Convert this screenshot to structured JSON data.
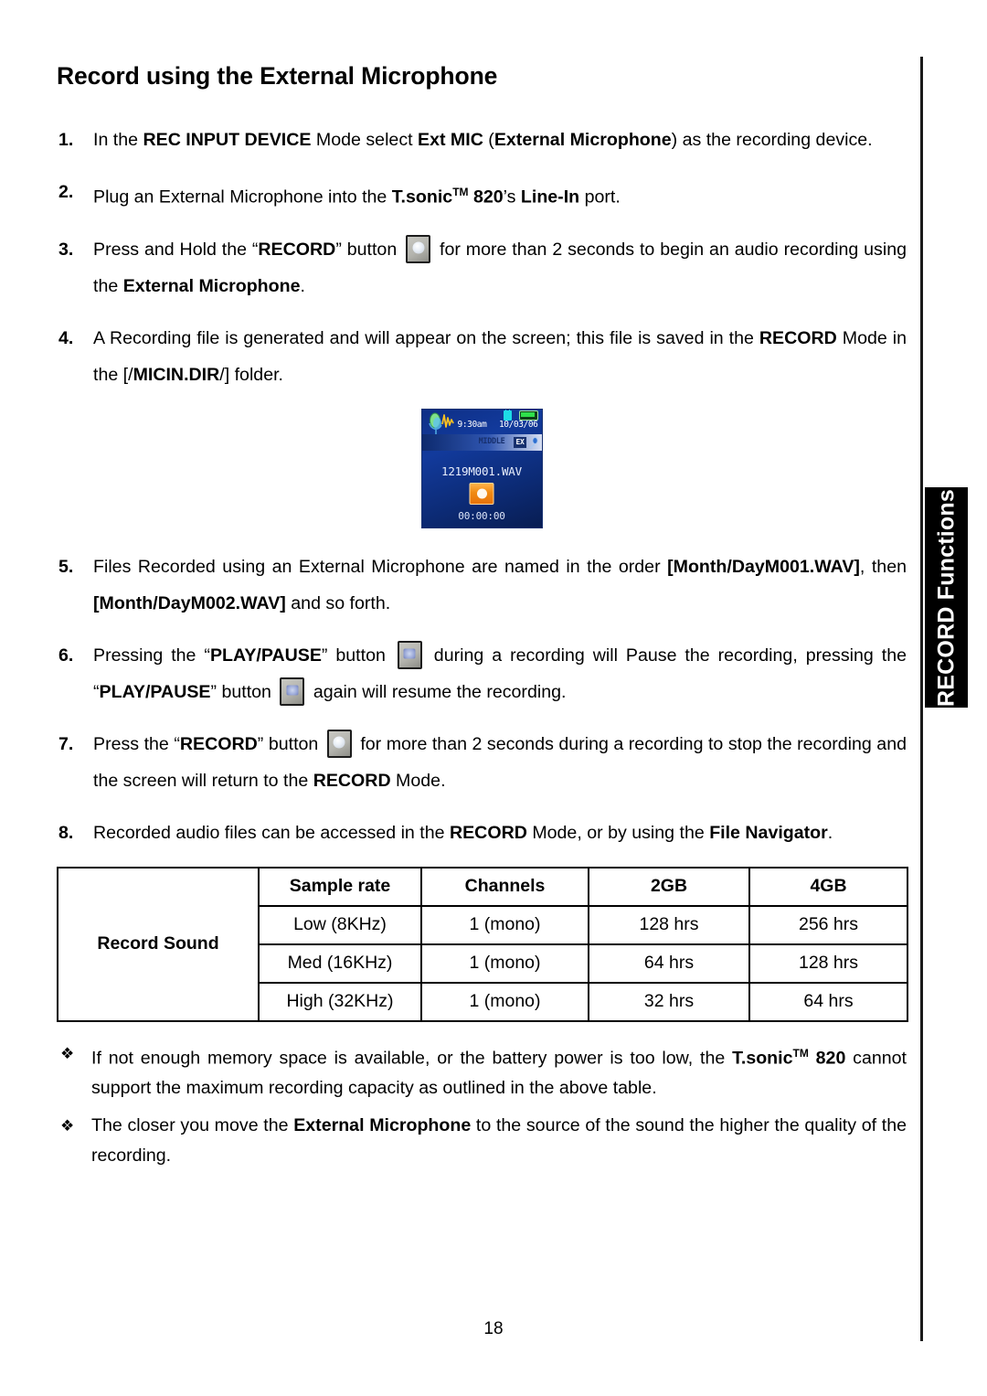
{
  "page": {
    "title": "Record using the External Microphone",
    "number": "18",
    "side_tab_label": "RECORD Functions"
  },
  "steps": [
    {
      "num": "1.",
      "parts": [
        {
          "t": "In the ",
          "b": false
        },
        {
          "t": "REC INPUT DEVICE",
          "b": true
        },
        {
          "t": " Mode select ",
          "b": false
        },
        {
          "t": "Ext MIC",
          "b": true
        },
        {
          "t": " (",
          "b": false
        },
        {
          "t": "External Microphone",
          "b": true
        },
        {
          "t": ") as the recording device.",
          "b": false
        }
      ]
    },
    {
      "num": "2.",
      "parts": [
        {
          "t": "Plug an External Microphone into the ",
          "b": false
        },
        {
          "t": "T.sonic",
          "b": true
        },
        {
          "t": "TM",
          "tm": true
        },
        {
          "t": " 820",
          "b": true
        },
        {
          "t": "’s ",
          "b": false
        },
        {
          "t": "Line-In",
          "b": true
        },
        {
          "t": " port.",
          "b": false
        }
      ]
    },
    {
      "num": "3.",
      "parts": [
        {
          "t": "Press and Hold the “",
          "b": false
        },
        {
          "t": "RECORD",
          "b": true
        },
        {
          "t": "” button ",
          "b": false
        },
        {
          "icon": "record-button-icon"
        },
        {
          "t": " for more than 2 seconds to begin an audio recording using the ",
          "b": false
        },
        {
          "t": "External Microphone",
          "b": true
        },
        {
          "t": ".",
          "b": false
        }
      ]
    },
    {
      "num": "4.",
      "parts": [
        {
          "t": "A Recording file is generated and will appear on the screen; this file is saved in the ",
          "b": false
        },
        {
          "t": "RECORD",
          "b": true
        },
        {
          "t": " Mode in the [/",
          "b": false
        },
        {
          "t": "MICIN.DIR",
          "b": true
        },
        {
          "t": "/] folder.",
          "b": false
        }
      ]
    },
    {
      "num": "5.",
      "parts": [
        {
          "t": "Files Recorded using an External Microphone are named in the order ",
          "b": false
        },
        {
          "t": "[Month/DayM001.WAV]",
          "b": true
        },
        {
          "t": ", then ",
          "b": false
        },
        {
          "t": "[Month/DayM002.WAV]",
          "b": true
        },
        {
          "t": " and so forth.",
          "b": false
        }
      ]
    },
    {
      "num": "6.",
      "parts": [
        {
          "t": "Pressing the “",
          "b": false
        },
        {
          "t": "PLAY/PAUSE",
          "b": true
        },
        {
          "t": "” button ",
          "b": false
        },
        {
          "icon": "play-pause-button-icon"
        },
        {
          "t": " during a recording will Pause the recording, pressing the “",
          "b": false
        },
        {
          "t": "PLAY/PAUSE",
          "b": true
        },
        {
          "t": "” button ",
          "b": false
        },
        {
          "icon": "play-pause-button-icon"
        },
        {
          "t": " again will resume the recording.",
          "b": false
        }
      ]
    },
    {
      "num": "7.",
      "parts": [
        {
          "t": "Press the “",
          "b": false
        },
        {
          "t": "RECORD",
          "b": true
        },
        {
          "t": "” button ",
          "b": false
        },
        {
          "icon": "record-button-icon"
        },
        {
          "t": " for more than 2 seconds during a recording to stop the recording and the screen will return to the ",
          "b": false
        },
        {
          "t": "RECORD",
          "b": true
        },
        {
          "t": " Mode.",
          "b": false
        }
      ]
    },
    {
      "num": "8.",
      "parts": [
        {
          "t": "Recorded audio files can be accessed in the ",
          "b": false
        },
        {
          "t": "RECORD",
          "b": true
        },
        {
          "t": " Mode, or by using the ",
          "b": false
        },
        {
          "t": "File Navigator",
          "b": true
        },
        {
          "t": ".",
          "b": false
        }
      ]
    }
  ],
  "device_screen": {
    "time": "9:30am",
    "date": "10/03/06",
    "quality_label": "MIDDLE",
    "input_label": "EX",
    "filename": "1219M001.WAV",
    "timer": "00:00:00",
    "icons": {
      "microphone": "microphone-waveform-icon",
      "lock": "lock-icon",
      "battery": "battery-icon",
      "ext_mic": "external-mic-icon",
      "record": "record-indicator-icon"
    },
    "colors": {
      "screen_bg": "#0e2f86",
      "record_button": "#f08a12",
      "battery": "#2fe04a",
      "lock": "#1ddbe6"
    }
  },
  "table": {
    "row_label": "Record Sound",
    "headers": [
      "Sample rate",
      "Channels",
      "2GB",
      "4GB"
    ],
    "rows": [
      [
        "Low (8KHz)",
        "1 (mono)",
        "128 hrs",
        "256 hrs"
      ],
      [
        "Med (16KHz)",
        "1 (mono)",
        "64 hrs",
        "128 hrs"
      ],
      [
        "High (32KHz)",
        "1 (mono)",
        "32 hrs",
        "64 hrs"
      ]
    ]
  },
  "notes": [
    {
      "bullet": "❖",
      "parts": [
        {
          "t": "If not enough memory space is available, or the battery power is too low, the ",
          "b": false
        },
        {
          "t": "T.sonic",
          "b": true
        },
        {
          "t": "TM",
          "tm": true
        },
        {
          "t": " 820",
          "b": true
        },
        {
          "t": " cannot support the maximum recording capacity as outlined in the above table.",
          "b": false
        }
      ]
    },
    {
      "bullet": "❖",
      "parts": [
        {
          "t": "The closer you move the ",
          "b": false
        },
        {
          "t": "External Microphone",
          "b": true
        },
        {
          "t": " to the source of the sound the higher the quality of the recording.",
          "b": false
        }
      ]
    }
  ]
}
